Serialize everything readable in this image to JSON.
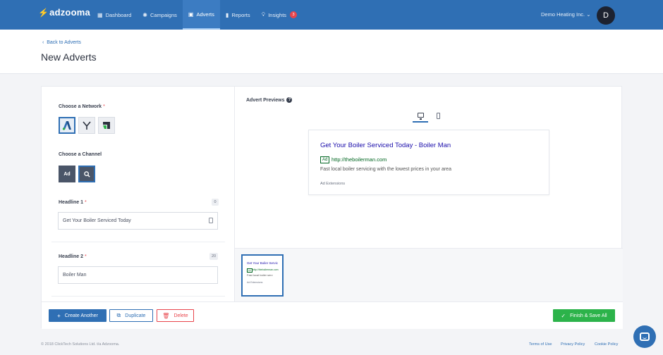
{
  "app": {
    "logo_text": "adzooma"
  },
  "nav": {
    "items": [
      {
        "label": "Dashboard",
        "icon": "dashboard-icon"
      },
      {
        "label": "Campaigns",
        "icon": "campaigns-icon"
      },
      {
        "label": "Adverts",
        "icon": "adverts-icon"
      },
      {
        "label": "Reports",
        "icon": "reports-icon"
      },
      {
        "label": "Insights",
        "icon": "lightbulb-icon",
        "badge": "3"
      }
    ],
    "active": "Adverts",
    "account_name": "Demo Heating Inc.",
    "avatar_letter": "D"
  },
  "page": {
    "back_link": "Back to Adverts",
    "title": "New Adverts"
  },
  "form": {
    "network_label": "Choose a Network",
    "networks": [
      {
        "name": "Google AdWords",
        "icon": "adwords-logo-icon",
        "selected": true
      },
      {
        "name": "Yahoo",
        "icon": "yahoo-logo-icon",
        "selected": false
      },
      {
        "name": "Bing",
        "icon": "bing-logo-icon",
        "selected": false
      }
    ],
    "channel_label": "Choose a Channel",
    "channels": [
      {
        "label": "Ad",
        "selected": false
      },
      {
        "label": "",
        "icon": "search-icon",
        "selected": true
      }
    ],
    "headline1": {
      "label": "Headline 1",
      "counter": "0",
      "value": "Get Your Boiler Serviced Today"
    },
    "headline2": {
      "label": "Headline 2",
      "counter": "20",
      "value": "Boiler Man"
    }
  },
  "preview": {
    "title": "Advert Previews",
    "devices": [
      "desktop-icon",
      "mobile-icon"
    ],
    "active_device": "desktop",
    "ad": {
      "headline": "Get Your Boiler Serviced Today - Boiler Man",
      "tag": "Ad",
      "url": "http://theboilerman.com",
      "description": "Fast local boiler servicing with the lowest prices in your area",
      "extensions": "Ad Extensions"
    },
    "thumb": {
      "headline": "Get Your Boiler Servic",
      "tag": "Ad",
      "url": "http://theboilerman.com",
      "description": "Fast local boiler serv",
      "extensions": "Ad Extensions"
    }
  },
  "actions": {
    "create_another": "Create Another",
    "duplicate": "Duplicate",
    "delete": "Delete",
    "finish": "Finish & Save All"
  },
  "footer": {
    "copyright": "© 2018 ClickTech Solutions Ltd. t/a Adzooma.",
    "links": [
      "Terms of Use",
      "Privacy Policy",
      "Cookie Policy"
    ]
  },
  "colors": {
    "brand_blue": "#2f6fb4",
    "success_green": "#2cb34a",
    "danger_red": "#e8454c",
    "ad_link": "#1a0dab",
    "ad_url": "#006621"
  }
}
